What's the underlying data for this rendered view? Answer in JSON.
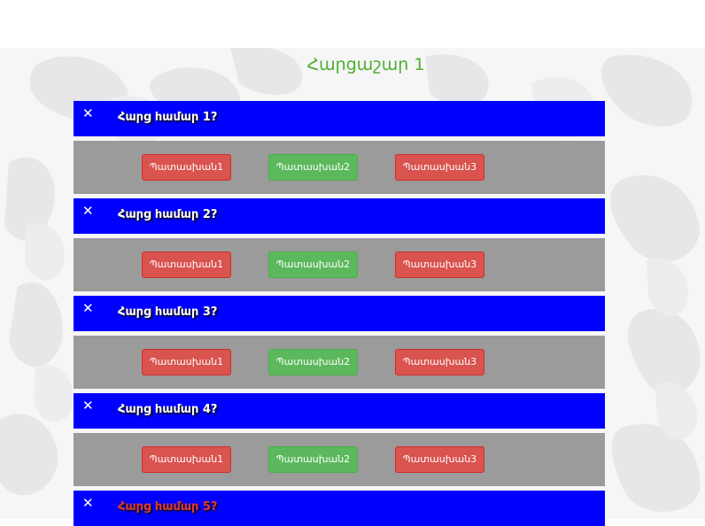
{
  "page": {
    "title": "Հարցաշար 1"
  },
  "colors": {
    "header_bg": "#0000ff",
    "answers_bg": "#9b9b9b",
    "title": "#4cae2f",
    "wrong": "#d9534f",
    "correct": "#5cb85c"
  },
  "questions": [
    {
      "close": "✕",
      "text": "Հարց համար 1?",
      "answers": [
        "Պատասխան1",
        "Պատասխան2",
        "Պատասխան3"
      ],
      "answer_states": [
        "wrong",
        "correct",
        "wrong"
      ]
    },
    {
      "close": "✕",
      "text": "Հարց համար 2?",
      "answers": [
        "Պատասխան1",
        "Պատասխան2",
        "Պատասխան3"
      ],
      "answer_states": [
        "wrong",
        "correct",
        "wrong"
      ]
    },
    {
      "close": "✕",
      "text": "Հարց համար 3?",
      "answers": [
        "Պատասխան1",
        "Պատասխան2",
        "Պատասխան3"
      ],
      "answer_states": [
        "wrong",
        "correct",
        "wrong"
      ]
    },
    {
      "close": "✕",
      "text": "Հարց համար 4?",
      "answers": [
        "Պատասխան1",
        "Պատասխան2",
        "Պատասխան3"
      ],
      "answer_states": [
        "wrong",
        "correct",
        "wrong"
      ]
    },
    {
      "close": "✕",
      "text": "Հարց համար 5?",
      "text_color": "red"
    }
  ]
}
